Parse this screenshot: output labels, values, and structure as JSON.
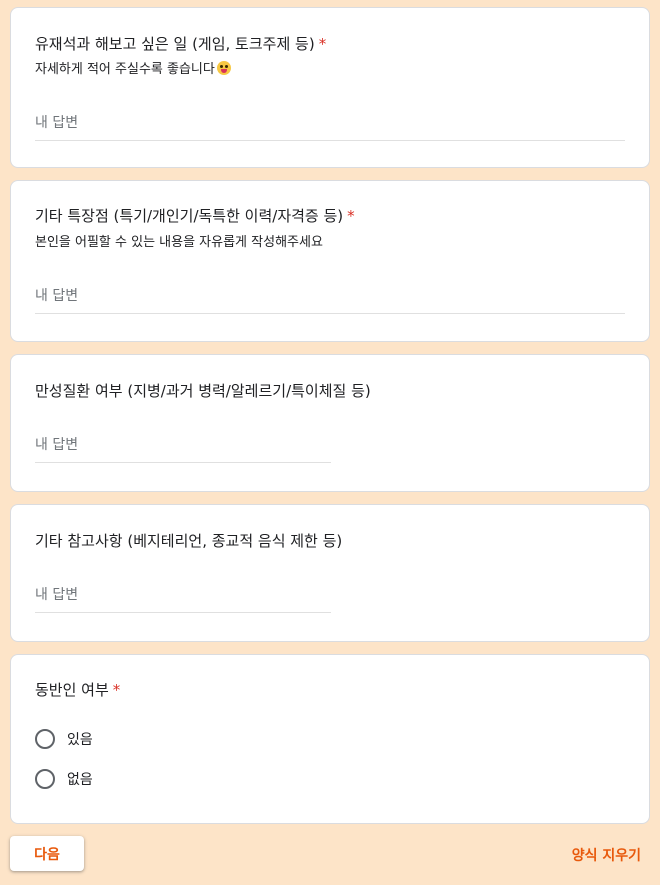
{
  "questions": [
    {
      "title": "유재석과 해보고 싶은 일 (게임, 토크주제 등)",
      "required_mark": "*",
      "description": "자세하게 적어 주실수록 좋습니다",
      "description_emoji": "grinning-tongue-emoji",
      "placeholder": "내 답변"
    },
    {
      "title": "기타 특장점 (특기/개인기/독특한 이력/자격증 등)",
      "required_mark": "*",
      "description": "본인을 어필할 수 있는 내용을 자유롭게 작성해주세요",
      "placeholder": "내 답변"
    },
    {
      "title": "만성질환 여부 (지병/과거 병력/알레르기/특이체질 등)",
      "placeholder": "내 답변"
    },
    {
      "title": "기타 참고사항 (베지테리언, 종교적 음식 제한 등)",
      "placeholder": "내 답변"
    },
    {
      "title": "동반인 여부",
      "required_mark": "*",
      "options": [
        "있음",
        "없음"
      ]
    }
  ],
  "footer": {
    "next_label": "다음",
    "clear_label": "양식 지우기"
  },
  "colors": {
    "background": "#fde4c8",
    "accent": "#e8590c",
    "required": "#d93025"
  }
}
